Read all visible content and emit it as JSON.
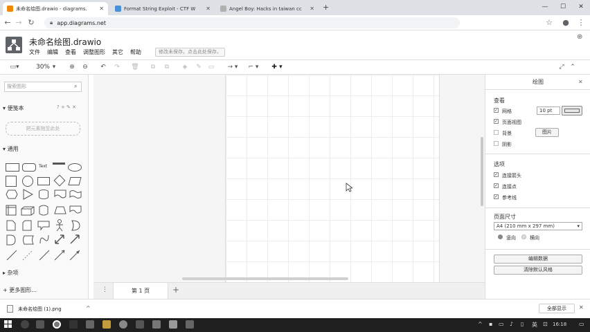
{
  "browser": {
    "tabs": [
      {
        "title": "未命名绘图.drawio - diagrams.",
        "active": true,
        "color": "#f08705"
      },
      {
        "title": "Format String Exploit - CTF W",
        "active": false,
        "color": "#4a90d9"
      },
      {
        "title": "Angel Boy: Hacks in taiwan cc",
        "active": false,
        "color": "#b0b0b0"
      }
    ],
    "new_tab": "+",
    "url": "app.diagrams.net",
    "window_controls": [
      "—",
      "☐",
      "✕"
    ]
  },
  "app": {
    "title": "未命名绘图.drawio",
    "menu": [
      "文件",
      "编辑",
      "查看",
      "调整图形",
      "其它",
      "帮助"
    ],
    "save_notice": "修改未保存。点击此处保存。"
  },
  "toolbar": {
    "zoom": "30%"
  },
  "left_panel": {
    "search_placeholder": "搜索图形",
    "scratchpad_title": "便笺本",
    "scratchpad_tools": "? + ✎ ✕",
    "drop_hint": "把元素拖至此处",
    "general_title": "通用",
    "text_shape": "Text",
    "misc_title": "杂项",
    "more_shapes": "+ 更多图形..."
  },
  "right_panel": {
    "title": "绘图",
    "view_title": "查看",
    "grid_label": "网格",
    "grid_checked": true,
    "grid_size": "10 pt",
    "page_view_label": "页面视图",
    "page_view_checked": true,
    "background_label": "背景",
    "background_checked": false,
    "image_button": "图片",
    "shadow_label": "阴影",
    "shadow_checked": false,
    "options_title": "选项",
    "connection_arrows_label": "连接箭头",
    "connection_arrows_checked": true,
    "connection_points_label": "连接点",
    "connection_points_checked": true,
    "guides_label": "参考线",
    "guides_checked": true,
    "paper_size_title": "页面尺寸",
    "paper_size_value": "A4 (210 mm x 297 mm)",
    "portrait_label": "竖向",
    "landscape_label": "横向",
    "edit_data_button": "编辑数据",
    "clear_style_button": "清除默认风格"
  },
  "page_tabs": {
    "current": "第 1 页",
    "add": "+"
  },
  "download_bar": {
    "file_name": "未命名绘图 (1).png",
    "show_all": "全部显示"
  },
  "taskbar": {
    "lang": "英",
    "time": "16:18"
  },
  "colors": {
    "accent": "#f08705",
    "panel_bg": "#fafafa",
    "taskbar": "#1f1f1f"
  }
}
